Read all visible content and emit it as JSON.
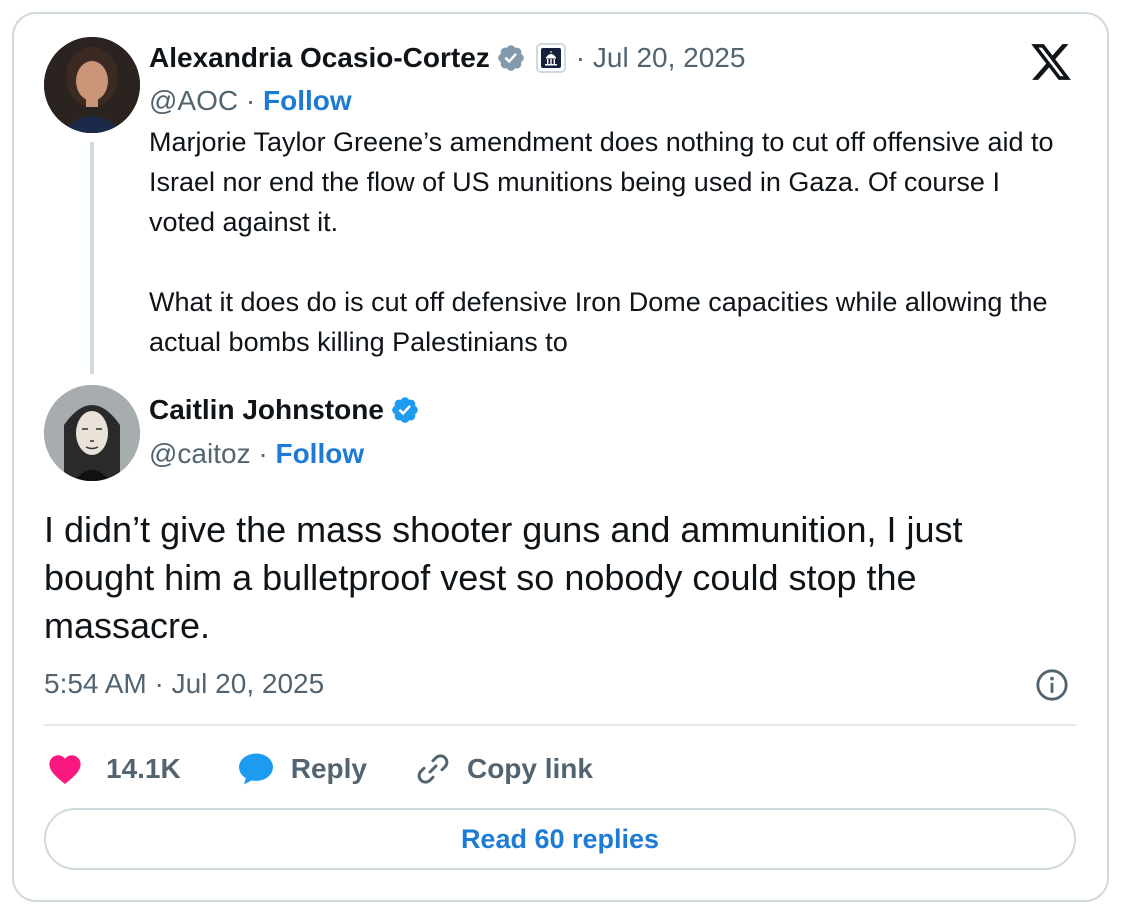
{
  "quoted_tweet": {
    "author_name": "Alexandria Ocasio-Cortez",
    "handle": "@AOC",
    "date": "· Jul 20, 2025",
    "follow_label": "Follow",
    "separator": "·",
    "text_paragraphs": [
      "Marjorie Taylor Greene’s amendment does nothing to cut off offensive aid to Israel nor end the flow of US munitions being used in Gaza. Of course I voted against it.",
      "What it does do is cut off defensive Iron Dome capacities while allowing the actual bombs killing Palestinians to"
    ]
  },
  "tweet": {
    "author_name": "Caitlin Johnstone",
    "handle": "@caitoz",
    "follow_label": "Follow",
    "separator": "·",
    "text": "I didn’t give the mass shooter guns and ammunition, I just bought him a bulletproof vest so nobody could stop the massacre.",
    "timestamp": "5:54 AM · Jul 20, 2025"
  },
  "actions": {
    "like_count": "14.1K",
    "reply_label": "Reply",
    "copy_link_label": "Copy link"
  },
  "read_replies_label": "Read 60 replies",
  "icons": {
    "platform": "x-logo-icon",
    "verified": "verified-badge-icon",
    "government": "capitol-building-icon",
    "like": "heart-icon",
    "reply": "speech-bubble-icon",
    "copy": "link-icon",
    "info": "info-icon"
  },
  "colors": {
    "accent": "#1d7bd6",
    "verified": "#1d9bf0",
    "like": "#f91880",
    "muted": "#536471",
    "border": "#cfd9de"
  }
}
